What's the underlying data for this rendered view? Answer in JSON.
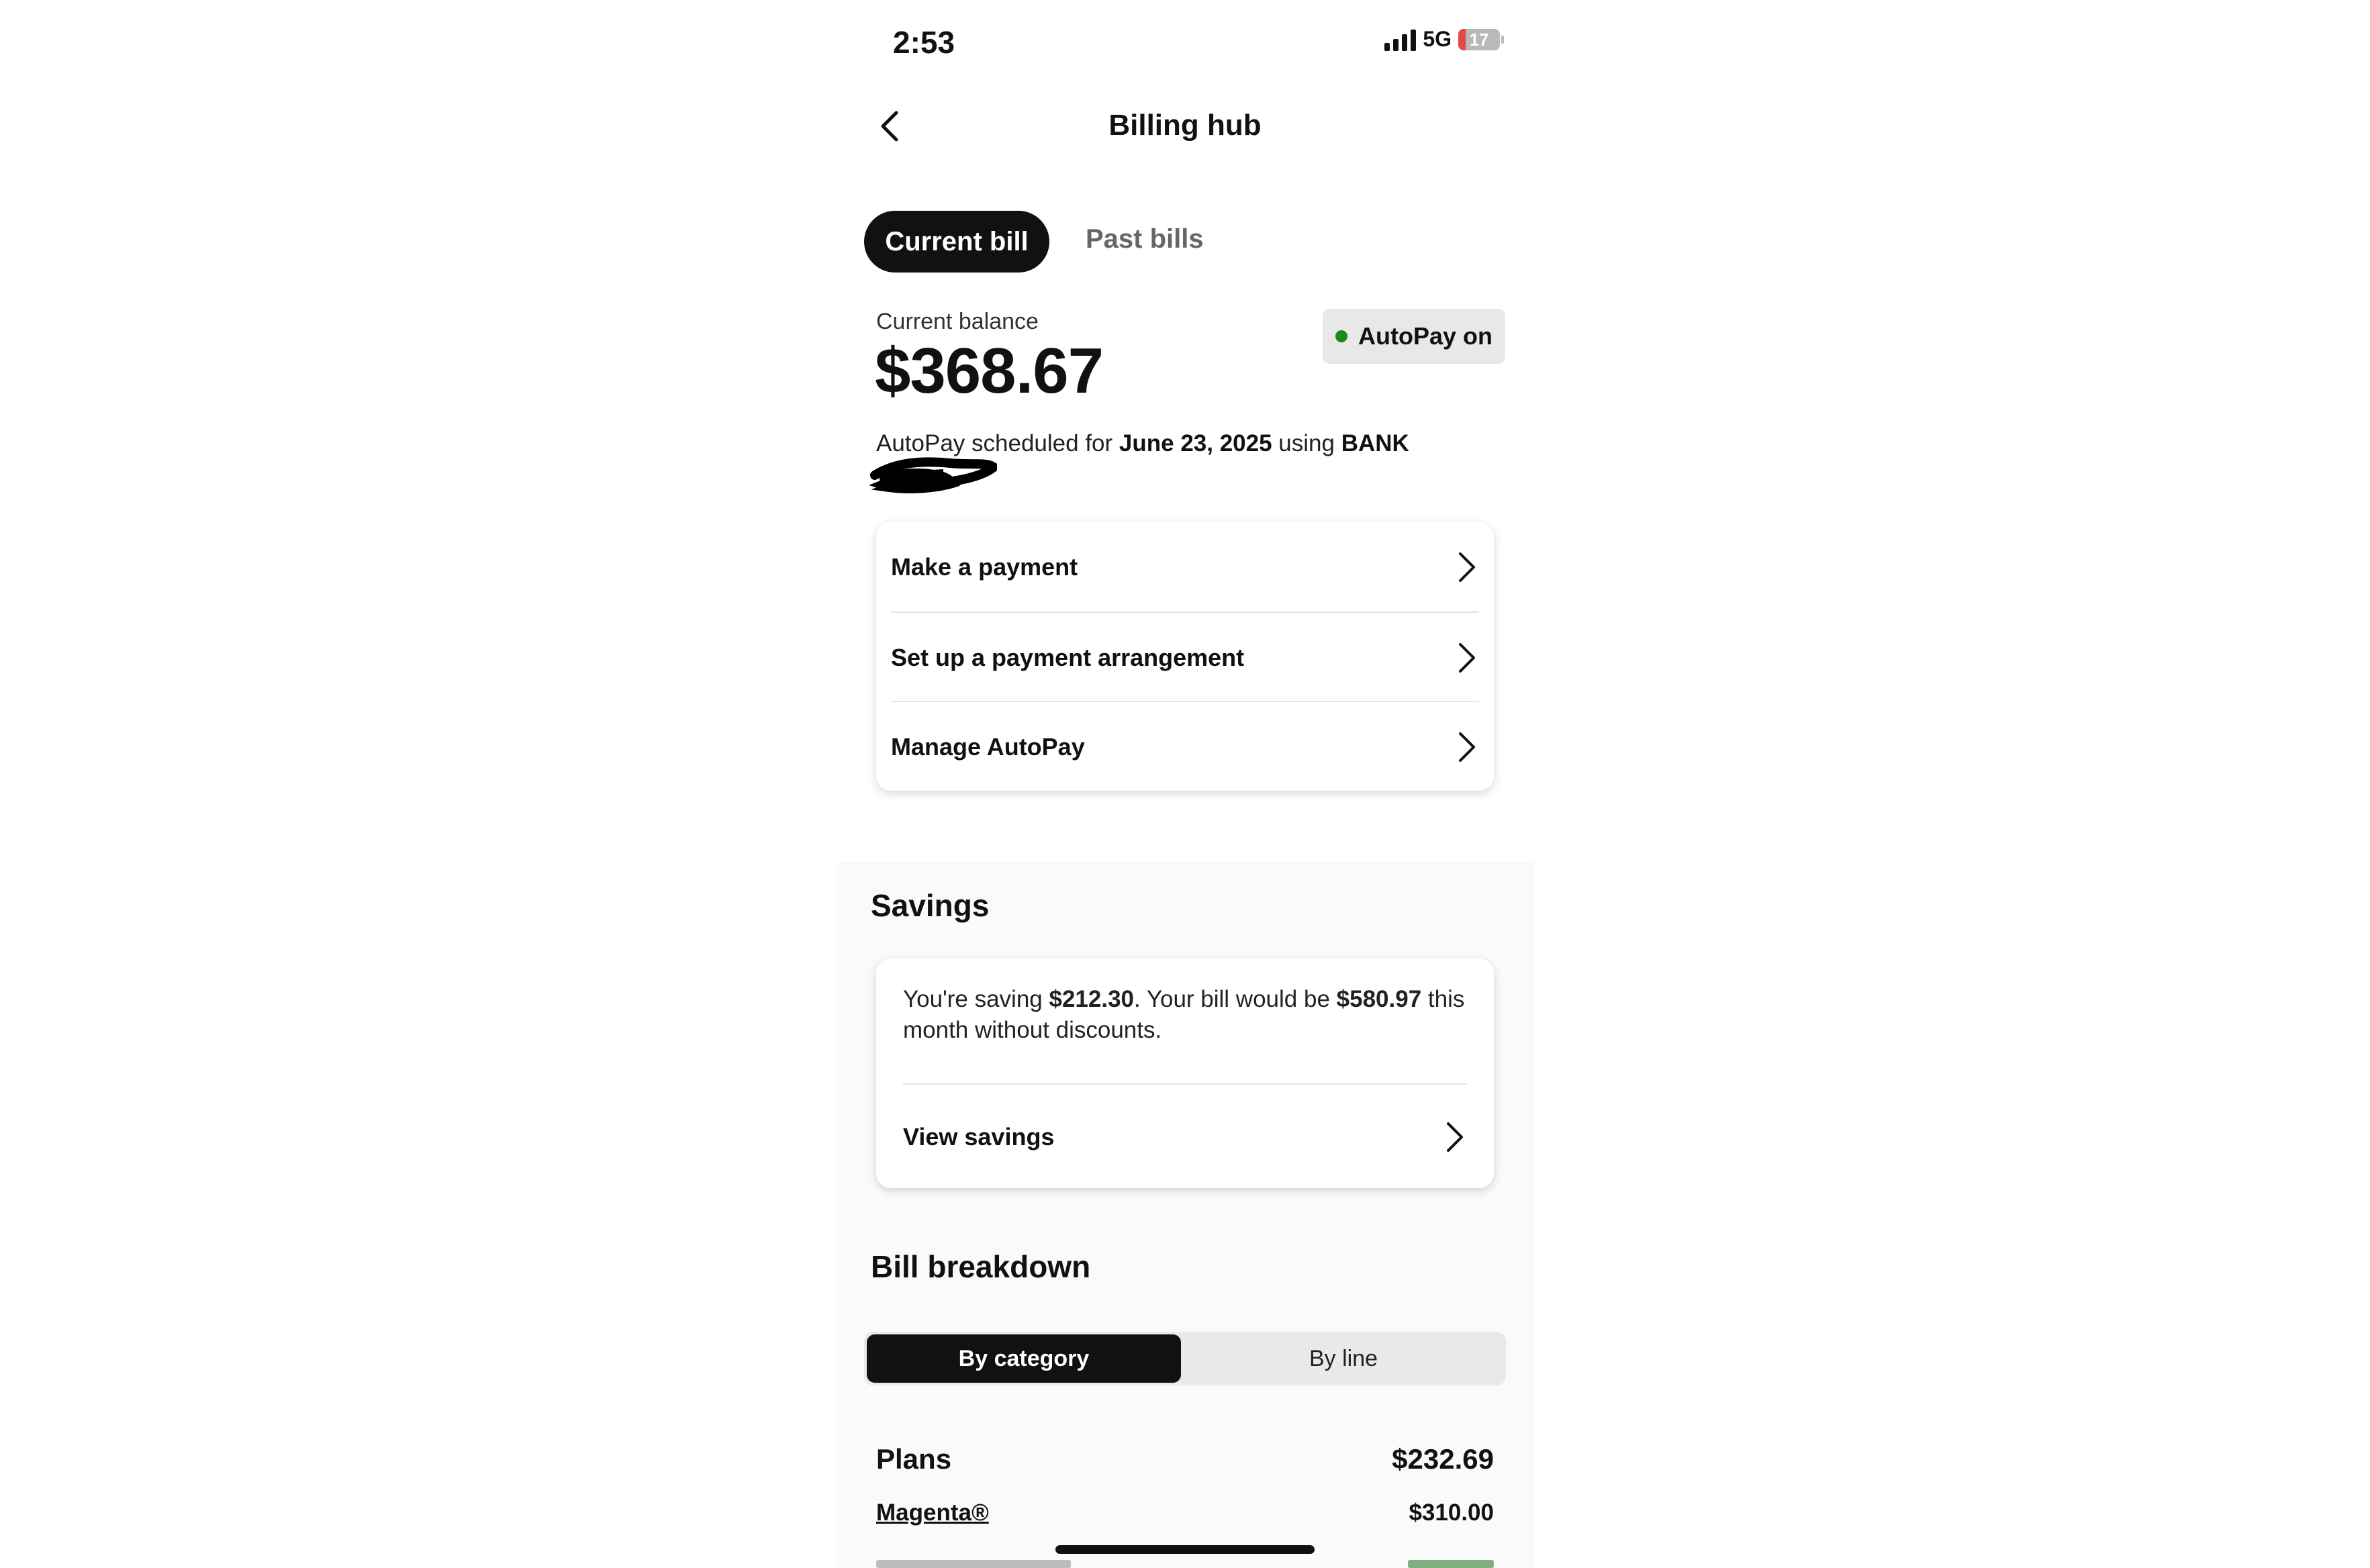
{
  "status_bar": {
    "time": "2:53",
    "network": "5G",
    "battery": "17",
    "battery_level": 0.17
  },
  "header": {
    "title": "Billing hub",
    "back_icon": "chevron-left-icon"
  },
  "tabs": [
    {
      "label": "Current bill",
      "active": true
    },
    {
      "label": "Past bills",
      "active": false
    }
  ],
  "balance": {
    "label": "Current balance",
    "amount": "$368.67",
    "autopay_badge": "AutoPay on",
    "autopay_color": "#1a8a1a",
    "schedule_prefix": "AutoPay scheduled for ",
    "schedule_date": "June 23, 2025",
    "schedule_middle": " using ",
    "schedule_method": "BANK"
  },
  "actions": [
    {
      "label": "Make a payment",
      "icon": "chevron-right-icon"
    },
    {
      "label": "Set up a payment arrangement",
      "icon": "chevron-right-icon"
    },
    {
      "label": "Manage AutoPay",
      "icon": "chevron-right-icon"
    }
  ],
  "savings": {
    "title": "Savings",
    "text_prefix": "You're saving ",
    "saving_amount": "$212.30",
    "text_middle": ". Your bill would be ",
    "would_be_amount": "$580.97",
    "text_suffix": " this month without discounts.",
    "link": "View savings"
  },
  "breakdown": {
    "title": "Bill breakdown",
    "segments": [
      {
        "label": "By category",
        "active": true
      },
      {
        "label": "By line",
        "active": false
      }
    ],
    "plans_label": "Plans",
    "plans_amount": "$232.69",
    "items": [
      {
        "label": "Magenta®",
        "amount": "$310.00"
      }
    ]
  }
}
